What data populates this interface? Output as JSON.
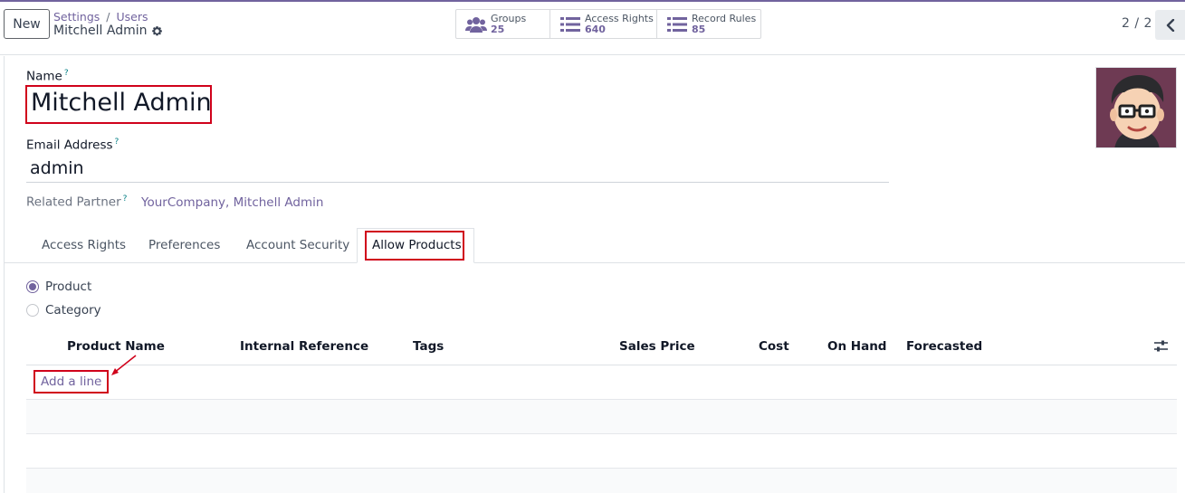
{
  "control_panel": {
    "new_label": "New",
    "breadcrumb": [
      "Settings",
      "Users"
    ],
    "breadcrumb_sep": "/",
    "record_name": "Mitchell Admin",
    "smart_buttons": [
      {
        "label": "Groups",
        "value": "25",
        "icon": "users-icon"
      },
      {
        "label": "Access Rights",
        "value": "640",
        "icon": "list-icon"
      },
      {
        "label": "Record Rules",
        "value": "85",
        "icon": "list-icon"
      }
    ],
    "pager": "2 / 2"
  },
  "form": {
    "name_label": "Name",
    "name_help": "?",
    "name_value": "Mitchell Admin",
    "email_label": "Email Address",
    "email_help": "?",
    "email_value": "admin",
    "partner_label": "Related Partner",
    "partner_help": "?",
    "partner_value": "YourCompany, Mitchell Admin"
  },
  "tabs": [
    "Access Rights",
    "Preferences",
    "Account Security",
    "Allow Products"
  ],
  "active_tab": "Allow Products",
  "allow_type": {
    "options": [
      "Product",
      "Category"
    ],
    "selected": "Product"
  },
  "table": {
    "columns": [
      "Product Name",
      "Internal Reference",
      "Tags",
      "Sales Price",
      "Cost",
      "On Hand",
      "Forecasted"
    ],
    "add_line": "Add a line"
  },
  "colors": {
    "brand": "#71639e",
    "highlight": "#d0021b"
  }
}
